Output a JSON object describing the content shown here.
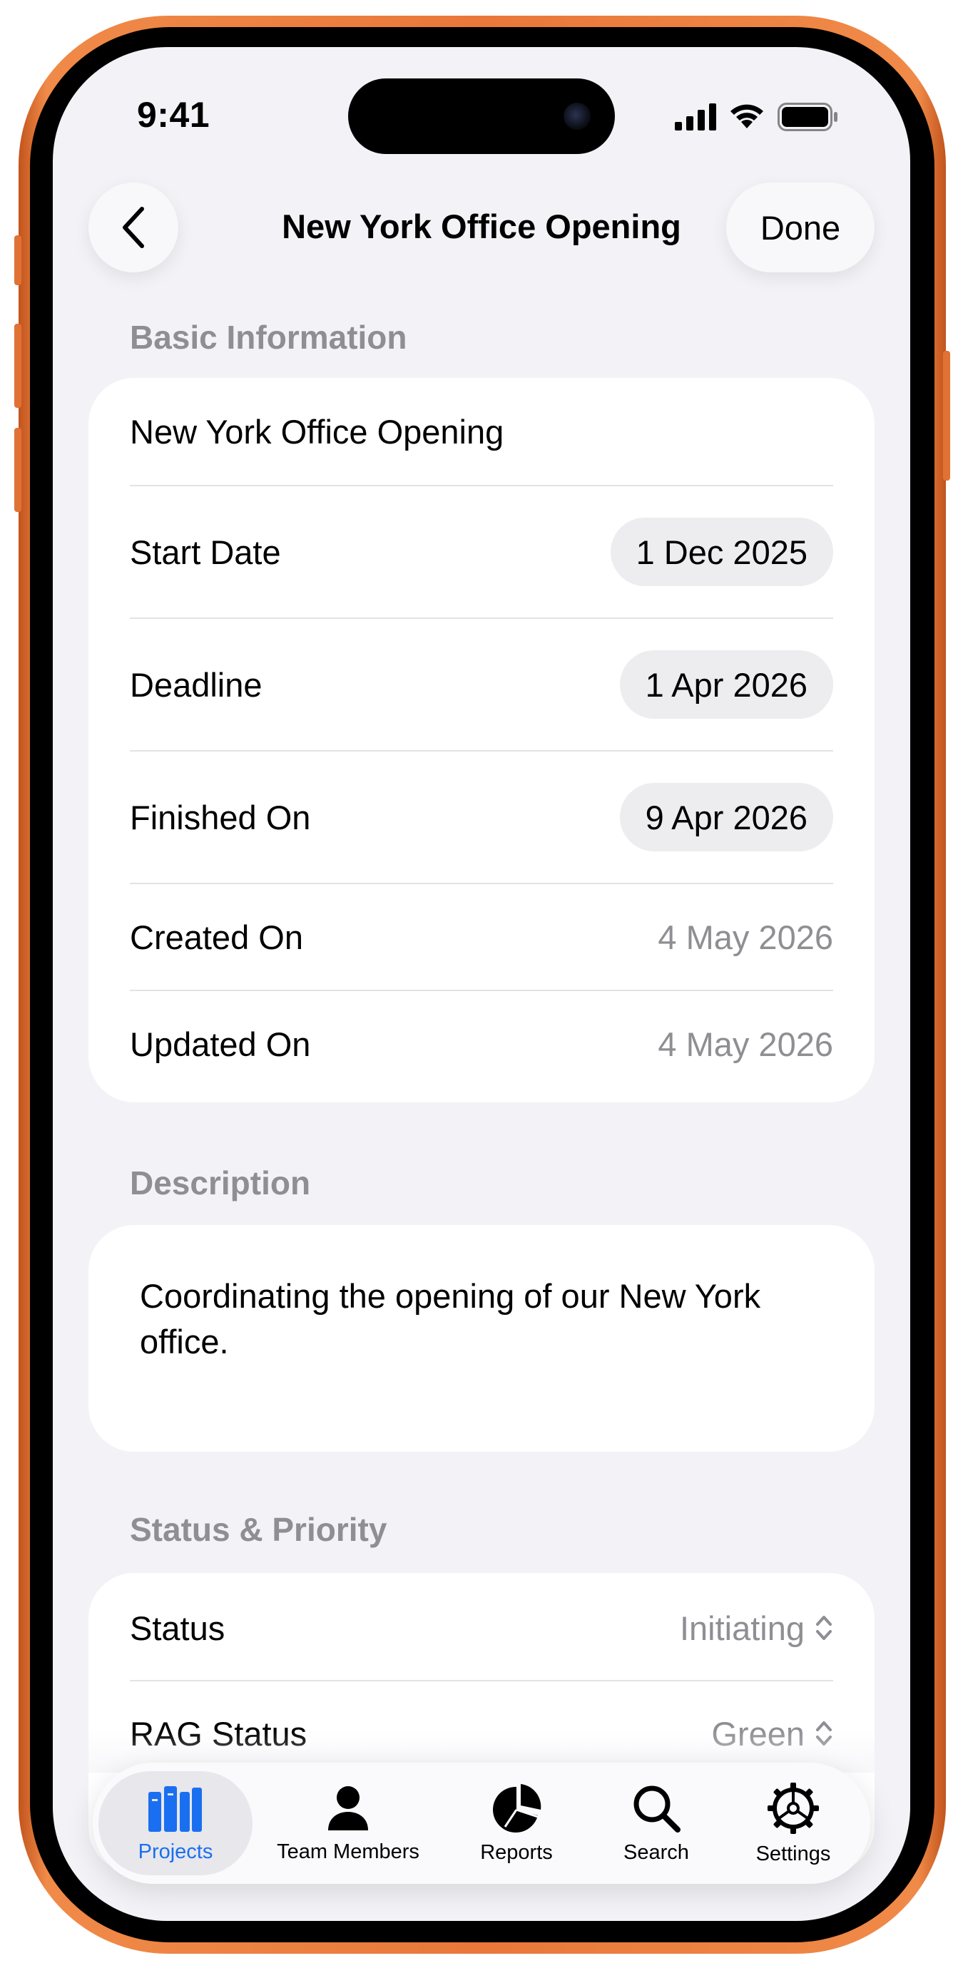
{
  "status_bar": {
    "time": "9:41"
  },
  "nav": {
    "title": "New York Office Opening",
    "done_label": "Done"
  },
  "basic_info": {
    "header": "Basic Information",
    "name_value": "New York Office Opening",
    "rows": [
      {
        "label": "Start Date",
        "value": "1 Dec 2025"
      },
      {
        "label": "Deadline",
        "value": "1 Apr 2026"
      },
      {
        "label": "Finished On",
        "value": "9 Apr 2026"
      },
      {
        "label": "Created On",
        "value": "4 May 2026"
      },
      {
        "label": "Updated On",
        "value": "4 May 2026"
      }
    ]
  },
  "description": {
    "header": "Description",
    "text": "Coordinating the opening of our New York office."
  },
  "status_priority": {
    "header": "Status & Priority",
    "rows": [
      {
        "label": "Status",
        "value": "Initiating"
      },
      {
        "label": "RAG Status",
        "value": "Green"
      }
    ]
  },
  "tabbar": {
    "tabs": [
      {
        "label": "Projects",
        "icon": "books-icon",
        "active": true
      },
      {
        "label": "Team Members",
        "icon": "person-icon",
        "active": false
      },
      {
        "label": "Reports",
        "icon": "pie-chart-icon",
        "active": false
      },
      {
        "label": "Search",
        "icon": "search-icon",
        "active": false
      },
      {
        "label": "Settings",
        "icon": "gear-icon",
        "active": false
      }
    ]
  },
  "colors": {
    "accent": "#1a6ff0",
    "device_frame": "#e9783a",
    "background": "#f2f2f7",
    "secondary_text": "#8e8e93"
  }
}
